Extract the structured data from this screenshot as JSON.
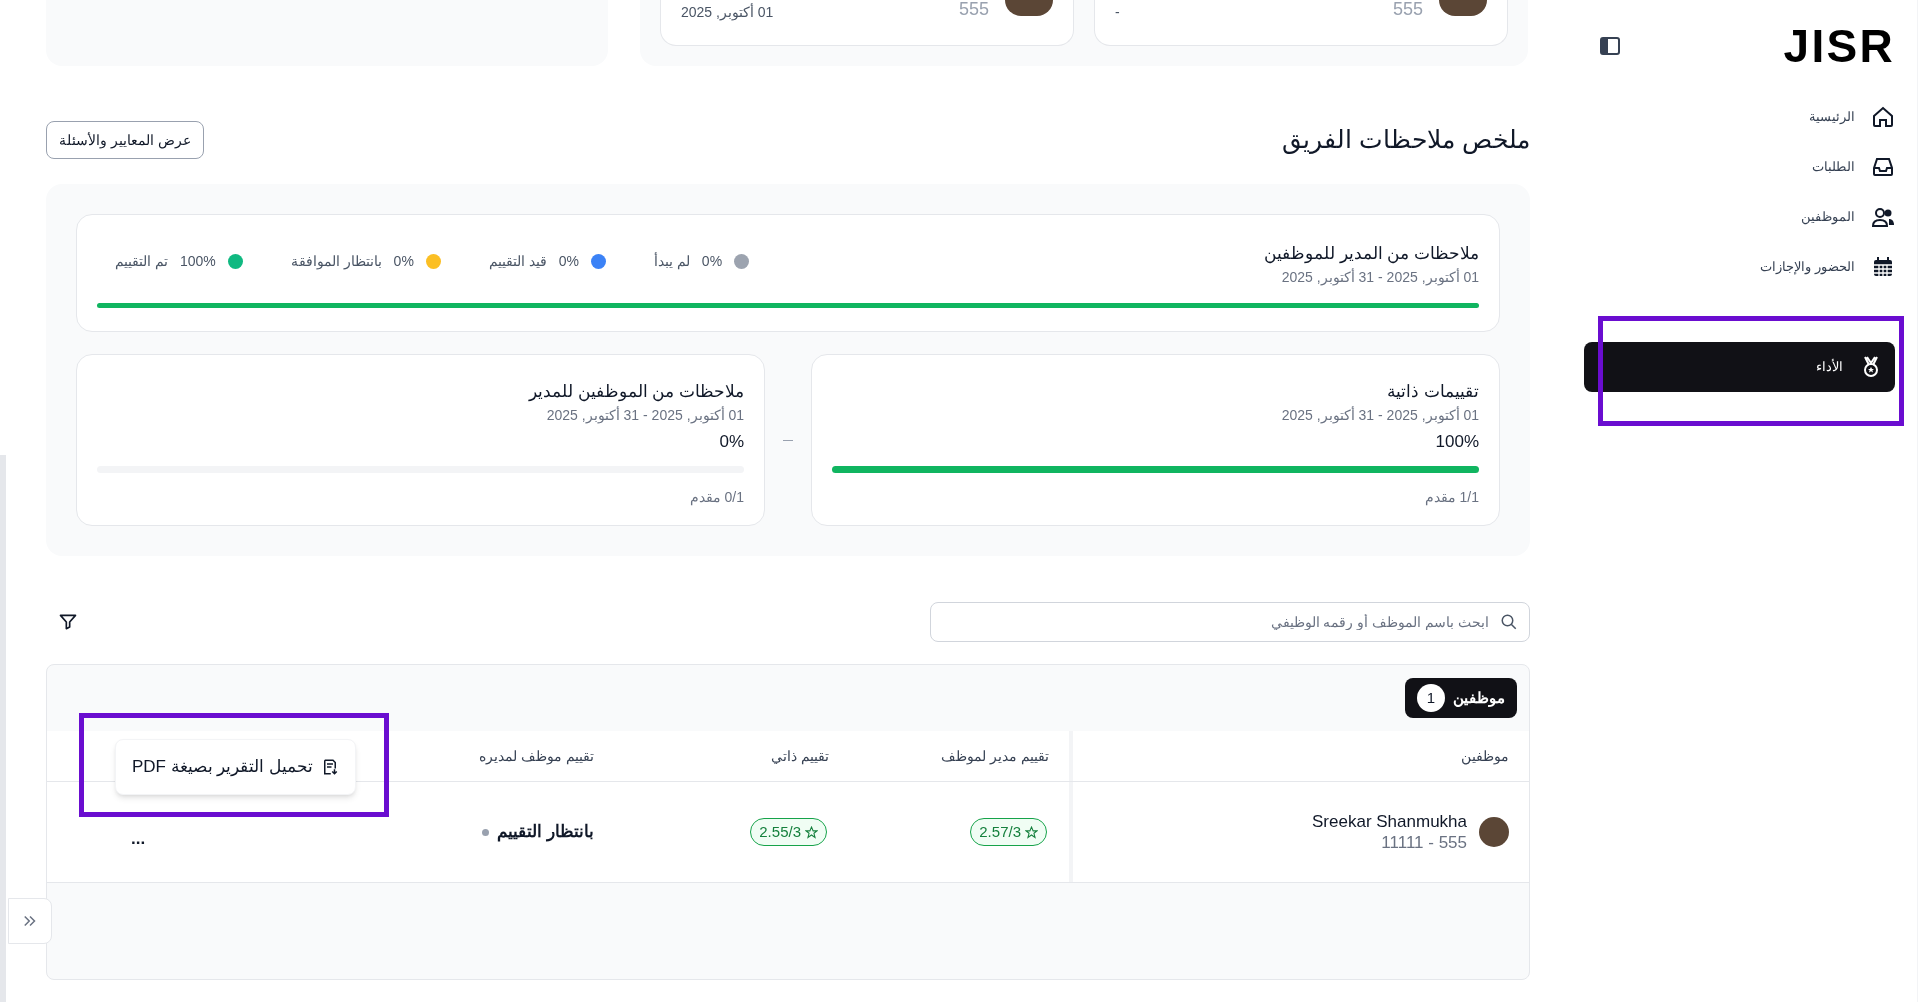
{
  "top_cards": [
    {
      "date": "-",
      "code": "555"
    },
    {
      "date": "01 أكتوبر, 2025",
      "code": "555"
    }
  ],
  "sidebar": {
    "logo": "JISR",
    "items": [
      {
        "label": "الرئيسية",
        "selected": false
      },
      {
        "label": "الطلبات",
        "selected": false
      },
      {
        "label": "الموظفين",
        "selected": false
      },
      {
        "label": "الحضور والإجازات",
        "selected": false
      },
      {
        "label": "الأداء",
        "selected": true
      }
    ]
  },
  "summary": {
    "title": "ملخص ملاحظات الفريق",
    "criteria_button": "عرض المعايير والأسئلة",
    "main_card": {
      "title": "ملاحظات من المدير للموظفين",
      "dates": "01 أكتوبر, 2025 - 31 أكتوبر, 2025",
      "level": 1,
      "legend": [
        {
          "percent": "0%",
          "label": "لم يبدأ",
          "color": "#9ca3af"
        },
        {
          "percent": "0%",
          "label": "قيد التقييم",
          "color": "#3b82f6"
        },
        {
          "percent": "0%",
          "label": "بانتظار الموافقة",
          "color": "#fbbf24"
        },
        {
          "percent": "100%",
          "label": "تم التقييم",
          "color": "#10b981"
        }
      ]
    },
    "cards": [
      {
        "title": "تقييمات ذاتية",
        "dates": "01 أكتوبر, 2025 - 31 أكتوبر, 2025",
        "percent": "100%",
        "level": 1,
        "progress": "1/1 مقدم"
      },
      {
        "title": "ملاحظات من الموظفين للمدير",
        "dates": "01 أكتوبر, 2025 - 31 أكتوبر, 2025",
        "percent": "0%",
        "level": 0,
        "progress": "0/1 مقدم"
      }
    ]
  },
  "search": {
    "placeholder": "ابحث باسم الموظف أو رقمه الوظيفي"
  },
  "table": {
    "count_tab": {
      "label": "موظفين",
      "count": "1"
    },
    "columns": [
      "موظفين",
      "تقييم مدير لموظف",
      "تقييم ذاتي",
      "تقييم موظف لمديره"
    ],
    "rows": [
      {
        "name": "Sreekar Shanmukha",
        "code": "11111 - 555",
        "manager_rating": "2.57/3",
        "self_rating": "2.55/3",
        "status": "بانتظار التقييم",
        "menu": "..."
      }
    ]
  },
  "popup_menu": {
    "label": "تحميل التقرير بصيغة PDF"
  }
}
